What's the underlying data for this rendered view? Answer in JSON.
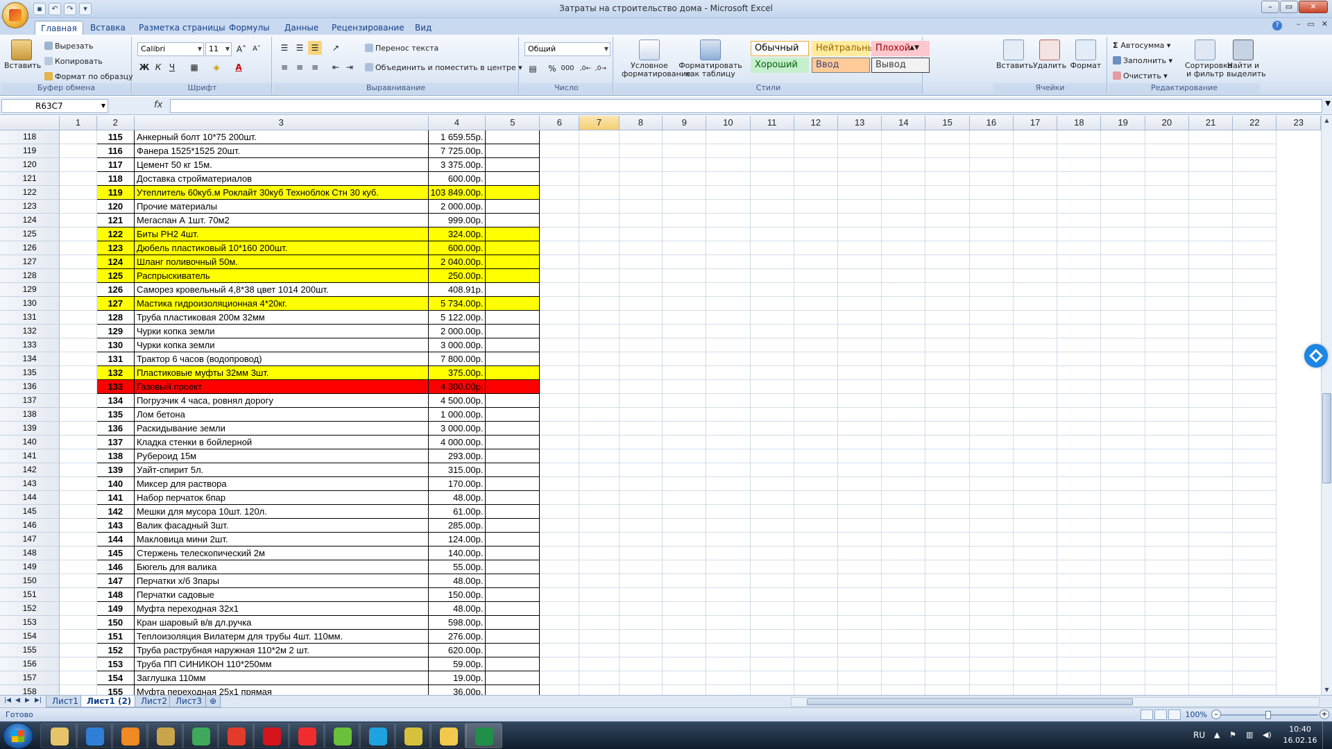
{
  "window": {
    "title": "Затраты на строительство дома - Microsoft Excel"
  },
  "quick_access": [
    "save-icon",
    "undo-icon",
    "redo-icon",
    "customize-icon"
  ],
  "window_controls": {
    "minimize": "–",
    "maximize": "▭",
    "close": "✕"
  },
  "tabs": [
    "Главная",
    "Вставка",
    "Разметка страницы",
    "Формулы",
    "Данные",
    "Рецензирование",
    "Вид"
  ],
  "ribbon": {
    "clipboard": {
      "label": "Буфер обмена",
      "paste": "Вставить",
      "cut": "Вырезать",
      "copy": "Копировать",
      "format_painter": "Формат по образцу"
    },
    "font": {
      "label": "Шрифт",
      "name": "Calibri",
      "size": "11",
      "bold": "Ж",
      "italic": "К",
      "underline": "Ч",
      "grow": "A˄",
      "shrink": "A˅",
      "color_letter": "A"
    },
    "alignment": {
      "label": "Выравнивание",
      "wrap": "Перенос текста",
      "merge": "Объединить и поместить в центре"
    },
    "number": {
      "label": "Число",
      "format": "Общий",
      "percent": "%",
      "thousands": "000"
    },
    "styles": {
      "label": "Стили",
      "conditional": "Условное форматирование",
      "as_table": "Форматировать как таблицу",
      "cells": [
        {
          "name": "Обычный",
          "bg": "#ffffff",
          "fg": "#000000",
          "border": "#f0a83a"
        },
        {
          "name": "Нейтральный",
          "bg": "#ffeb9c",
          "fg": "#9c6500",
          "border": "#ffeb9c"
        },
        {
          "name": "Плохой",
          "bg": "#ffc7ce",
          "fg": "#9c0006",
          "border": "#ffc7ce"
        },
        {
          "name": "Хороший",
          "bg": "#c6efce",
          "fg": "#006100",
          "border": "#c6efce"
        },
        {
          "name": "Ввод",
          "bg": "#ffcc99",
          "fg": "#3f3f76",
          "border": "#7f7f7f"
        },
        {
          "name": "Вывод",
          "bg": "#f2f2f2",
          "fg": "#3f3f3f",
          "border": "#3f3f3f"
        }
      ]
    },
    "cells": {
      "label": "Ячейки",
      "insert": "Вставить",
      "delete": "Удалить",
      "format": "Формат"
    },
    "editing": {
      "label": "Редактирование",
      "autosum": "Автосумма",
      "fill": "Заполнить",
      "clear": "Очистить",
      "sort": "Сортировка и фильтр",
      "find": "Найти и выделить"
    }
  },
  "formula_bar": {
    "name_box": "R63C7",
    "fx": "fx",
    "formula": ""
  },
  "columns": [
    "1",
    "2",
    "3",
    "4",
    "5",
    "6",
    "7",
    "8",
    "9",
    "10",
    "11",
    "12",
    "13",
    "14",
    "15",
    "16",
    "17",
    "18",
    "19",
    "20",
    "21",
    "22",
    "23"
  ],
  "highlight_column": "7",
  "rows": [
    {
      "r": "118",
      "n": "115",
      "item": "Анкерный болт 10*75 200шт.",
      "amt": "1 659.55р.",
      "hl": ""
    },
    {
      "r": "119",
      "n": "116",
      "item": "Фанера 1525*1525 20шт.",
      "amt": "7 725.00р.",
      "hl": ""
    },
    {
      "r": "120",
      "n": "117",
      "item": "Цемент 50 кг 15м.",
      "amt": "3 375.00р.",
      "hl": ""
    },
    {
      "r": "121",
      "n": "118",
      "item": "Доставка стройматериалов",
      "amt": "600.00р.",
      "hl": ""
    },
    {
      "r": "122",
      "n": "119",
      "item": "Утеплитель 60куб.м Роклайт 30куб Техноблок Стн 30 куб.",
      "amt": "103 849.00р.",
      "hl": "yellow"
    },
    {
      "r": "123",
      "n": "120",
      "item": "Прочие материалы",
      "amt": "2 000.00р.",
      "hl": ""
    },
    {
      "r": "124",
      "n": "121",
      "item": "Мегаспан А 1шт. 70м2",
      "amt": "999.00р.",
      "hl": ""
    },
    {
      "r": "125",
      "n": "122",
      "item": "Биты PH2 4шт.",
      "amt": "324.00р.",
      "hl": "yellow"
    },
    {
      "r": "126",
      "n": "123",
      "item": "Дюбель пластиковый 10*160 200шт.",
      "amt": "600.00р.",
      "hl": "yellow"
    },
    {
      "r": "127",
      "n": "124",
      "item": "Шланг поливочный 50м.",
      "amt": "2 040.00р.",
      "hl": "yellow"
    },
    {
      "r": "128",
      "n": "125",
      "item": "Распрыскиватель",
      "amt": "250.00р.",
      "hl": "yellow"
    },
    {
      "r": "129",
      "n": "126",
      "item": "Саморез кровельный 4,8*38 цвет 1014 200шт.",
      "amt": "408.91р.",
      "hl": ""
    },
    {
      "r": "130",
      "n": "127",
      "item": "Мастика гидроизоляционная 4*20кг.",
      "amt": "5 734.00р.",
      "hl": "yellow"
    },
    {
      "r": "131",
      "n": "128",
      "item": "Труба пластиковая 200м 32мм",
      "amt": "5 122.00р.",
      "hl": ""
    },
    {
      "r": "132",
      "n": "129",
      "item": "Чурки копка земли",
      "amt": "2 000.00р.",
      "hl": ""
    },
    {
      "r": "133",
      "n": "130",
      "item": "Чурки копка земли",
      "amt": "3 000.00р.",
      "hl": ""
    },
    {
      "r": "134",
      "n": "131",
      "item": "Трактор 6 часов (водопровод)",
      "amt": "7 800.00р.",
      "hl": ""
    },
    {
      "r": "135",
      "n": "132",
      "item": "Пластиковые муфты 32мм 3шт.",
      "amt": "375.00р.",
      "hl": "yellow"
    },
    {
      "r": "136",
      "n": "133",
      "item": "Газовый проект",
      "amt": "4 300.00р.",
      "hl": "red"
    },
    {
      "r": "137",
      "n": "134",
      "item": "Погрузчик 4 часа, ровнял дорогу",
      "amt": "4 500.00р.",
      "hl": ""
    },
    {
      "r": "138",
      "n": "135",
      "item": "Лом бетона",
      "amt": "1 000.00р.",
      "hl": ""
    },
    {
      "r": "139",
      "n": "136",
      "item": "Раскидывание земли",
      "amt": "3 000.00р.",
      "hl": ""
    },
    {
      "r": "140",
      "n": "137",
      "item": "Кладка стенки в бойлерной",
      "amt": "4 000.00р.",
      "hl": ""
    },
    {
      "r": "141",
      "n": "138",
      "item": "Рубероид 15м",
      "amt": "293.00р.",
      "hl": ""
    },
    {
      "r": "142",
      "n": "139",
      "item": "Уайт-спирит 5л.",
      "amt": "315.00р.",
      "hl": ""
    },
    {
      "r": "143",
      "n": "140",
      "item": "Миксер для раствора",
      "amt": "170.00р.",
      "hl": ""
    },
    {
      "r": "144",
      "n": "141",
      "item": "Набор перчаток 6пар",
      "amt": "48.00р.",
      "hl": ""
    },
    {
      "r": "145",
      "n": "142",
      "item": "Мешки для мусора 10шт. 120л.",
      "amt": "61.00р.",
      "hl": ""
    },
    {
      "r": "146",
      "n": "143",
      "item": "Валик фасадный 3шт.",
      "amt": "285.00р.",
      "hl": ""
    },
    {
      "r": "147",
      "n": "144",
      "item": "Макловица мини 2шт.",
      "amt": "124.00р.",
      "hl": ""
    },
    {
      "r": "148",
      "n": "145",
      "item": "Стержень телескопический 2м",
      "amt": "140.00р.",
      "hl": ""
    },
    {
      "r": "149",
      "n": "146",
      "item": "Бюгель для валика",
      "amt": "55.00р.",
      "hl": ""
    },
    {
      "r": "150",
      "n": "147",
      "item": "Перчатки х/б 3пары",
      "amt": "48.00р.",
      "hl": ""
    },
    {
      "r": "151",
      "n": "148",
      "item": "Перчатки садовые",
      "amt": "150.00р.",
      "hl": ""
    },
    {
      "r": "152",
      "n": "149",
      "item": "Муфта переходная 32х1",
      "amt": "48.00р.",
      "hl": ""
    },
    {
      "r": "153",
      "n": "150",
      "item": "Кран шаровый в/в дл.ручка",
      "amt": "598.00р.",
      "hl": ""
    },
    {
      "r": "154",
      "n": "151",
      "item": "Теплоизоляция Вилатерм для трубы 4шт. 110мм.",
      "amt": "276.00р.",
      "hl": ""
    },
    {
      "r": "155",
      "n": "152",
      "item": "Труба раструбная наружная 110*2м 2 шт.",
      "amt": "620.00р.",
      "hl": ""
    },
    {
      "r": "156",
      "n": "153",
      "item": "Труба ПП СИНИКОН 110*250мм",
      "amt": "59.00р.",
      "hl": ""
    },
    {
      "r": "157",
      "n": "154",
      "item": "Заглушка 110мм",
      "amt": "19.00р.",
      "hl": ""
    },
    {
      "r": "158",
      "n": "155",
      "item": "Муфта переходная 25х1 прямая",
      "amt": "36.00р.",
      "hl": ""
    }
  ],
  "sheet_tabs": [
    "Лист1",
    "Лист1 (2)",
    "Лист2",
    "Лист3"
  ],
  "active_sheet": "Лист1 (2)",
  "status": {
    "text": "Готово",
    "zoom": "100%"
  },
  "taskbar": {
    "apps": [
      "explorer-icon",
      "ie-icon",
      "media-player-icon",
      "paint-icon",
      "chrome-icon",
      "yandex-icon",
      "opera-icon",
      "yandex-browser-icon",
      "utorrent-icon",
      "skype-icon",
      "archiver-icon",
      "outlook-icon",
      "excel-icon"
    ],
    "lang": "RU",
    "time": "10:40",
    "date": "16.02.16"
  }
}
